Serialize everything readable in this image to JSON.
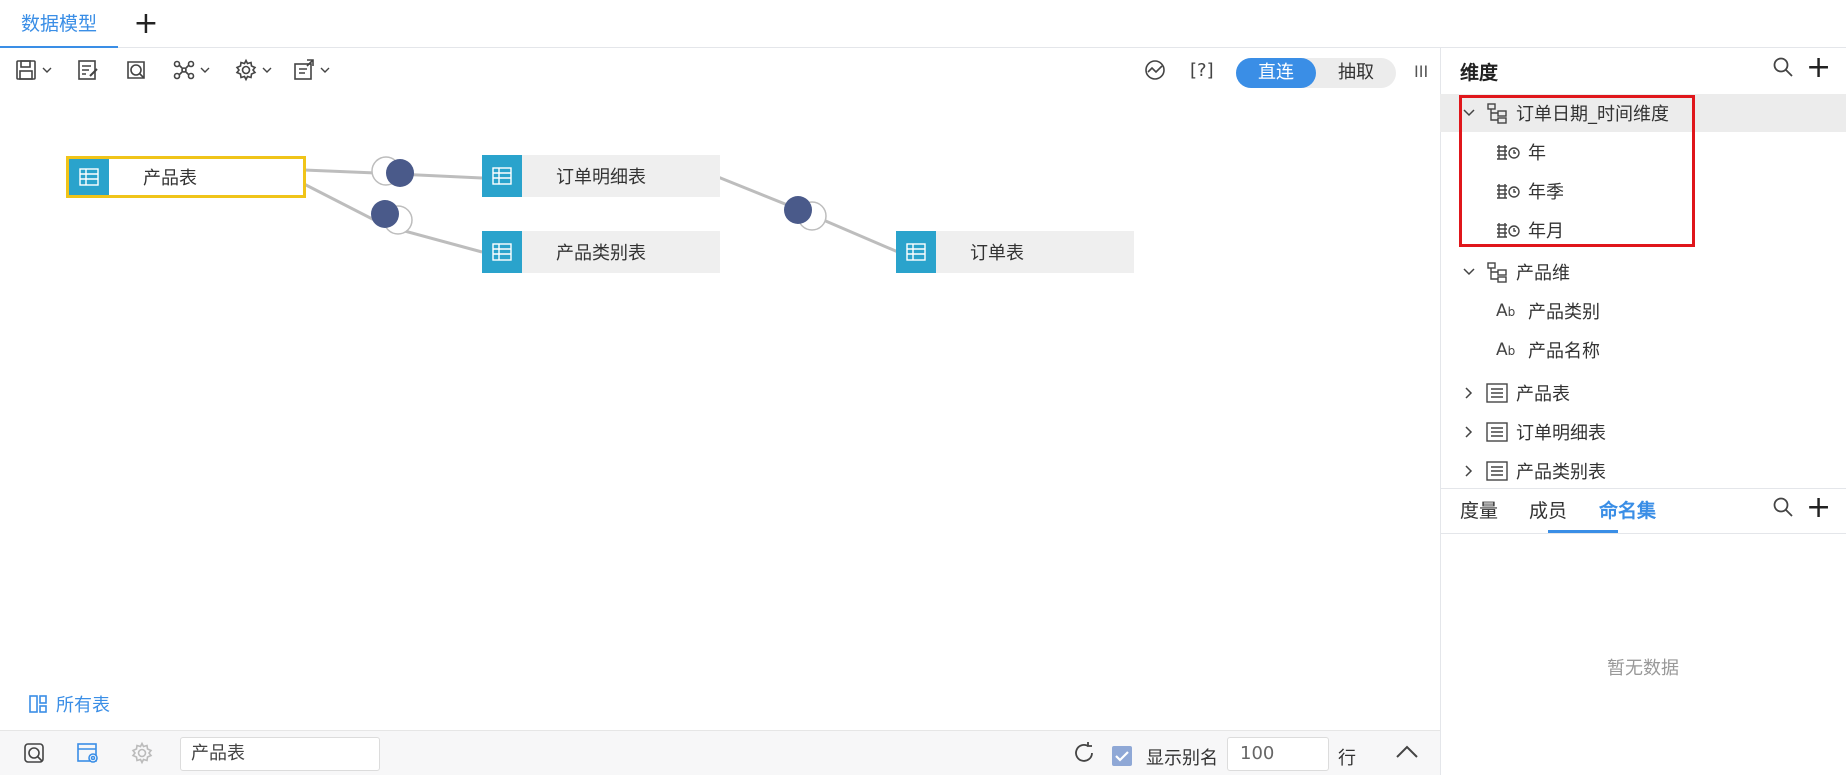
{
  "tabs": {
    "active_label": "数据模型",
    "add_icon": "plus-icon"
  },
  "toolbar": {
    "left_icons": [
      "save-icon",
      "edit-icon",
      "preview-icon",
      "relation-icon",
      "settings-icon",
      "deploy-icon"
    ],
    "help_label": "[?]",
    "mode_direct": "直连",
    "mode_extract": "抽取",
    "toggle_active_color": "#3a8ee6"
  },
  "canvas": {
    "tables": [
      {
        "label": "产品表",
        "selected": true
      },
      {
        "label": "订单明细表",
        "selected": false
      },
      {
        "label": "产品类别表",
        "selected": false
      },
      {
        "label": "订单表",
        "selected": false
      }
    ],
    "all_tables_label": "所有表",
    "node_icon_color": "#2aa3cc",
    "join_color": "#4a5a8a"
  },
  "bottom_bar": {
    "selected_table": "产品表",
    "show_alias_label": "显示别名",
    "show_alias_checked": true,
    "rows_value": "100",
    "rows_unit": "行"
  },
  "right_panel": {
    "title": "维度",
    "tree": [
      {
        "label": "订单日期_时间维度",
        "type": "hierarchy",
        "expanded": true,
        "highlighted": true
      },
      {
        "label": "年",
        "type": "date-level"
      },
      {
        "label": "年季",
        "type": "date-level"
      },
      {
        "label": "年月",
        "type": "date-level"
      },
      {
        "label": "产品维",
        "type": "hierarchy",
        "expanded": true
      },
      {
        "label": "产品类别",
        "type": "text-field"
      },
      {
        "label": "产品名称",
        "type": "text-field"
      },
      {
        "label": "产品表",
        "type": "table",
        "expanded": false
      },
      {
        "label": "订单明细表",
        "type": "table",
        "expanded": false
      },
      {
        "label": "产品类别表",
        "type": "table",
        "expanded": false
      }
    ],
    "bottom_tabs": [
      "度量",
      "成员",
      "命名集"
    ],
    "bottom_active_tab": "命名集",
    "empty_text": "暂无数据",
    "highlight_box_color": "#e0161b"
  }
}
